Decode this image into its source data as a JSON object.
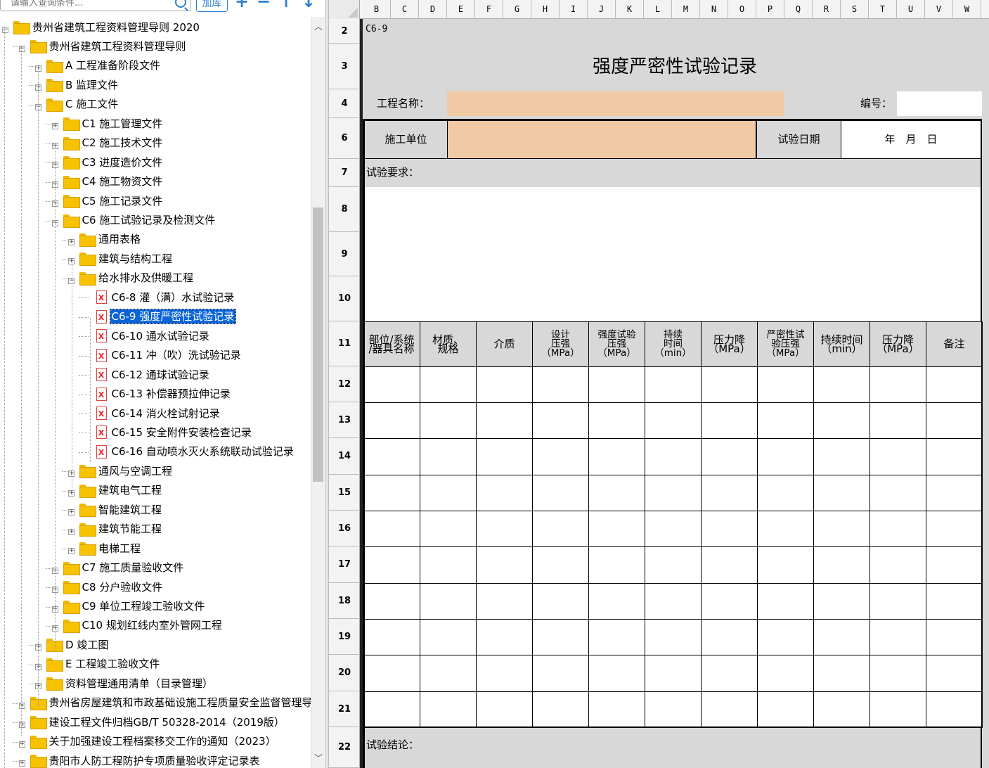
{
  "toolbar": {
    "search_placeholder": "请输入查询条件...",
    "search_icon": "search-icon",
    "add_library_label": "加库",
    "plus_label": "+",
    "minus_label": "−",
    "up_label": "↑",
    "down_label": "↓"
  },
  "tree": [
    {
      "label": "贵州省建筑工程资料管理导则 2020",
      "level": 0,
      "expander": "−",
      "icon": "folder"
    },
    {
      "label": "贵州省建筑工程资料管理导则",
      "level": 1,
      "expander": "−",
      "icon": "folder"
    },
    {
      "label": "A 工程准备阶段文件",
      "level": 2,
      "expander": "+",
      "icon": "folder"
    },
    {
      "label": "B 监理文件",
      "level": 2,
      "expander": "+",
      "icon": "folder"
    },
    {
      "label": "C 施工文件",
      "level": 2,
      "expander": "−",
      "icon": "folder"
    },
    {
      "label": "C1 施工管理文件",
      "level": 3,
      "expander": "+",
      "icon": "folder"
    },
    {
      "label": "C2 施工技术文件",
      "level": 3,
      "expander": "+",
      "icon": "folder"
    },
    {
      "label": "C3 进度造价文件",
      "level": 3,
      "expander": "+",
      "icon": "folder"
    },
    {
      "label": "C4 施工物资文件",
      "level": 3,
      "expander": "+",
      "icon": "folder"
    },
    {
      "label": "C5 施工记录文件",
      "level": 3,
      "expander": "+",
      "icon": "folder"
    },
    {
      "label": "C6 施工试验记录及检测文件",
      "level": 3,
      "expander": "−",
      "icon": "folder"
    },
    {
      "label": "通用表格",
      "level": 4,
      "expander": "+",
      "icon": "folder"
    },
    {
      "label": "建筑与结构工程",
      "level": 4,
      "expander": "+",
      "icon": "folder"
    },
    {
      "label": "给水排水及供暖工程",
      "level": 4,
      "expander": "−",
      "icon": "folder"
    },
    {
      "label": "C6-8 灌（满）水试验记录",
      "level": 5,
      "expander": "",
      "icon": "xfile"
    },
    {
      "label": "C6-9 强度严密性试验记录",
      "level": 5,
      "expander": "",
      "icon": "xfile",
      "selected": true
    },
    {
      "label": "C6-10 通水试验记录",
      "level": 5,
      "expander": "",
      "icon": "xfile"
    },
    {
      "label": "C6-11 冲（吹）洗试验记录",
      "level": 5,
      "expander": "",
      "icon": "xfile"
    },
    {
      "label": "C6-12 通球试验记录",
      "level": 5,
      "expander": "",
      "icon": "xfile"
    },
    {
      "label": "C6-13 补偿器预拉伸记录",
      "level": 5,
      "expander": "",
      "icon": "xfile"
    },
    {
      "label": "C6-14 消火栓试射记录",
      "level": 5,
      "expander": "",
      "icon": "xfile"
    },
    {
      "label": "C6-15 安全附件安装检查记录",
      "level": 5,
      "expander": "",
      "icon": "xfile"
    },
    {
      "label": "C6-16 自动喷水灭火系统联动试验记录",
      "level": 5,
      "expander": "",
      "icon": "xfile"
    },
    {
      "label": "通风与空调工程",
      "level": 4,
      "expander": "+",
      "icon": "folder"
    },
    {
      "label": "建筑电气工程",
      "level": 4,
      "expander": "+",
      "icon": "folder"
    },
    {
      "label": "智能建筑工程",
      "level": 4,
      "expander": "+",
      "icon": "folder"
    },
    {
      "label": "建筑节能工程",
      "level": 4,
      "expander": "+",
      "icon": "folder"
    },
    {
      "label": "电梯工程",
      "level": 4,
      "expander": "+",
      "icon": "folder"
    },
    {
      "label": "C7 施工质量验收文件",
      "level": 3,
      "expander": "+",
      "icon": "folder"
    },
    {
      "label": "C8 分户验收文件",
      "level": 3,
      "expander": "+",
      "icon": "folder"
    },
    {
      "label": "C9 单位工程竣工验收文件",
      "level": 3,
      "expander": "+",
      "icon": "folder"
    },
    {
      "label": "C10 规划红线内室外管网工程",
      "level": 3,
      "expander": "+",
      "icon": "folder"
    },
    {
      "label": "D 竣工图",
      "level": 2,
      "expander": "+",
      "icon": "folder"
    },
    {
      "label": "E 工程竣工验收文件",
      "level": 2,
      "expander": "+",
      "icon": "folder"
    },
    {
      "label": "资料管理通用清单（目录管理）",
      "level": 2,
      "expander": "+",
      "icon": "folder"
    },
    {
      "label": "贵州省房屋建筑和市政基础设施工程质量安全监督管理导",
      "level": 1,
      "expander": "+",
      "icon": "folder"
    },
    {
      "label": "建设工程文件归档GB/T 50328-2014（2019版）",
      "level": 1,
      "expander": "+",
      "icon": "folder"
    },
    {
      "label": "关于加强建设工程档案移交工作的通知（2023）",
      "level": 1,
      "expander": "+",
      "icon": "folder"
    },
    {
      "label": "贵阳市人防工程防护专项质量验收评定记录表",
      "level": 1,
      "expander": "+",
      "icon": "folder"
    }
  ],
  "columns": [
    "B",
    "C",
    "D",
    "E",
    "F",
    "G",
    "H",
    "I",
    "J",
    "K",
    "L",
    "M",
    "N",
    "O",
    "P",
    "Q",
    "R",
    "S",
    "T",
    "U",
    "V",
    "W"
  ],
  "rows": [
    "2",
    "3",
    "4",
    "6",
    "7",
    "8",
    "9",
    "10",
    "11",
    "12",
    "13",
    "14",
    "15",
    "16",
    "17",
    "18",
    "19",
    "20",
    "21",
    "22"
  ],
  "form": {
    "code": "C6-9",
    "title": "强度严密性试验记录",
    "project_name_label": "工程名称：",
    "number_label": "编号：",
    "construction_unit_label": "施工单位",
    "test_date_label": "试验日期",
    "date_placeholder": "年　月　日",
    "requirements_label": "试验要求：",
    "conclusion_label": "试验结论：",
    "headers": [
      "部位/系统\n/器具名称",
      "材质、\n规格",
      "介质",
      "设计\n压强\n（MPa）",
      "强度试验\n压强\n（MPa）",
      "持续\n时间\n（min）",
      "压力降\n（MPa）",
      "严密性试\n验压强\n（MPa）",
      "持续时间\n（min）",
      "压力降\n（MPa）",
      "备注"
    ],
    "input_fill_color": "#f2c9a5",
    "label_fill_color": "#d8d8d8"
  }
}
